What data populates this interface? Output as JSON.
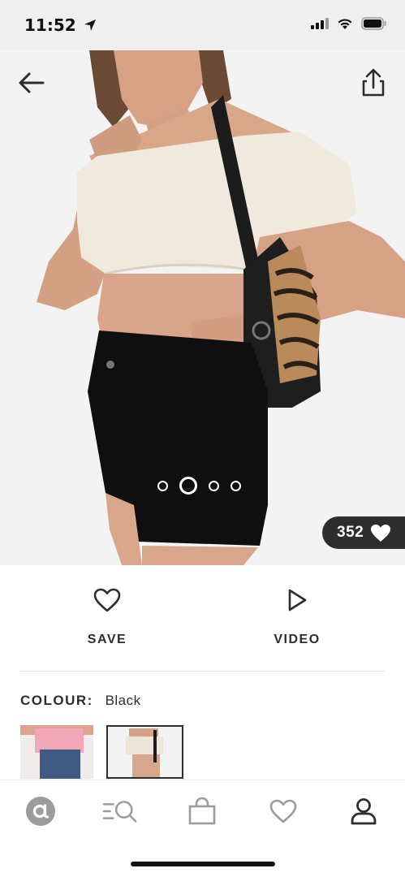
{
  "status_bar": {
    "time": "11:52"
  },
  "product_image": {
    "current_slide": 2,
    "slide_count": 4
  },
  "likes": {
    "count": "352"
  },
  "actions": {
    "save_label": "SAVE",
    "video_label": "VIDEO"
  },
  "colour": {
    "label": "COLOUR:",
    "value": "Black"
  },
  "tab_bar": {
    "items": [
      "home",
      "search",
      "bag",
      "saved",
      "account"
    ]
  },
  "colors": {
    "text": "#2d2d2d",
    "badge_bg": "#2d2d2d",
    "status_bg": "#efefef"
  }
}
